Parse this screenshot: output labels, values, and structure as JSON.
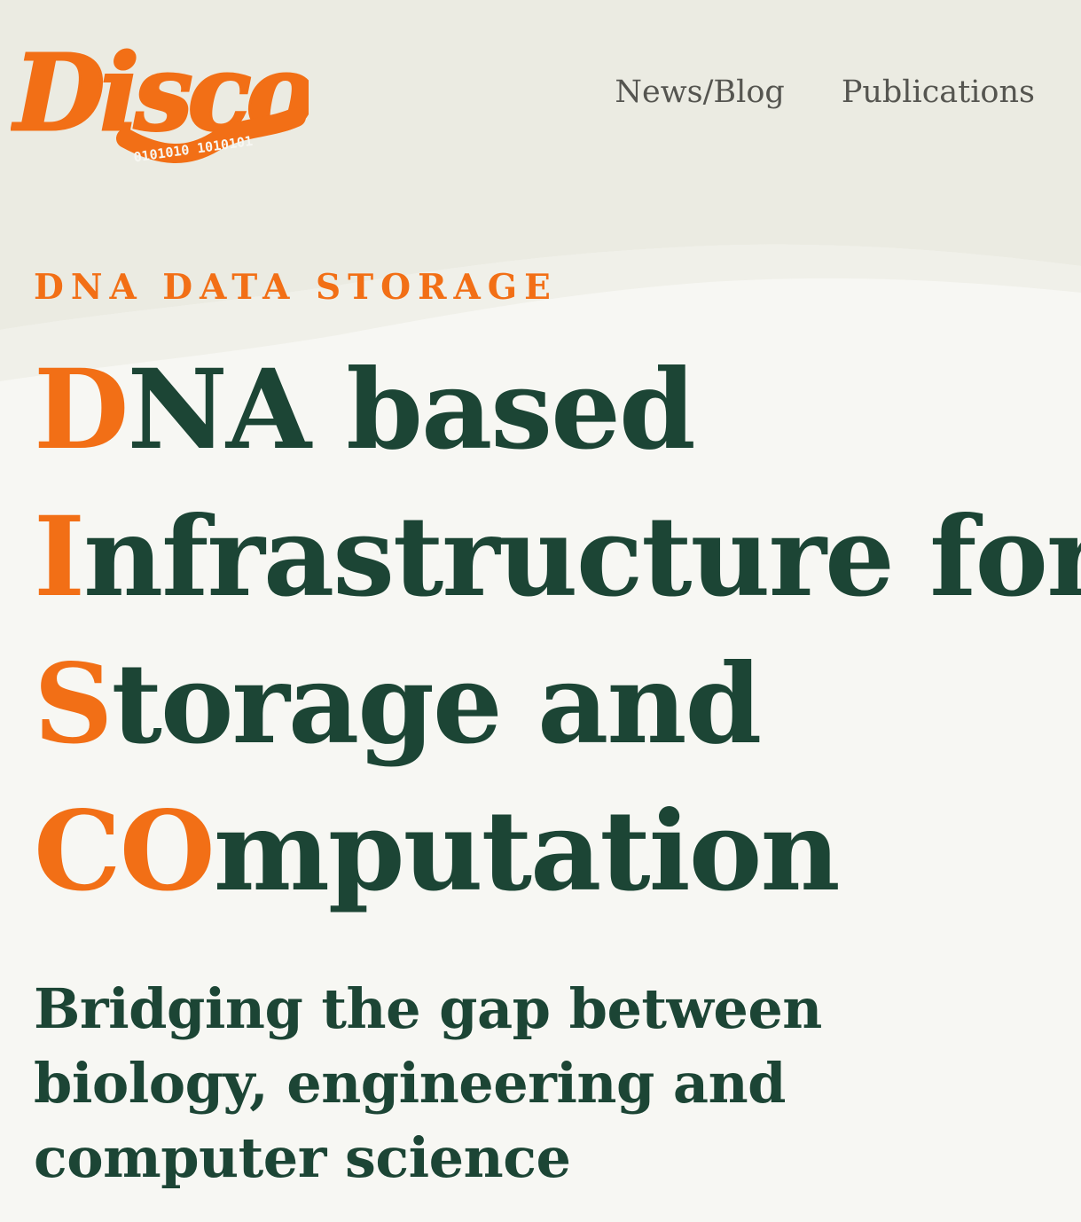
{
  "colors": {
    "accent": "#f26f16",
    "heading": "#1c4535",
    "nav_text": "#555550",
    "background_top": "#ebebe2",
    "background_main": "#f7f7f3"
  },
  "logo": {
    "text": "Disco",
    "dna_text": "0101010 1010101"
  },
  "nav": {
    "items": [
      {
        "label": "News/Blog"
      },
      {
        "label": "Publications"
      }
    ]
  },
  "hero": {
    "eyebrow": "DNA DATA STORAGE",
    "title_lines": [
      {
        "accent": "D",
        "rest": "NA based"
      },
      {
        "accent": "I",
        "rest": "nfrastructure for"
      },
      {
        "accent": "S",
        "rest": "torage and"
      },
      {
        "accent": "CO",
        "rest": "mputation"
      }
    ],
    "subtitle": "Bridging the gap between biology, engineering and computer science"
  }
}
